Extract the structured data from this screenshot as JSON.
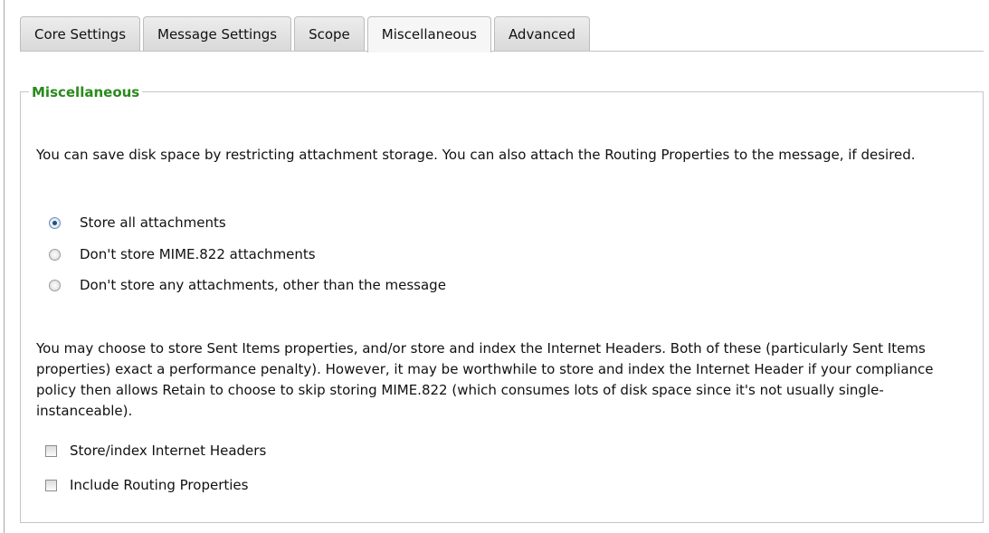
{
  "tabs": [
    {
      "label": "Core Settings",
      "active": false
    },
    {
      "label": "Message Settings",
      "active": false
    },
    {
      "label": "Scope",
      "active": false
    },
    {
      "label": "Miscellaneous",
      "active": true
    },
    {
      "label": "Advanced",
      "active": false
    }
  ],
  "section": {
    "legend": "Miscellaneous",
    "intro": "You can save disk space by restricting attachment storage. You can also attach the Routing Properties to the message, if desired.",
    "attachment_options": [
      {
        "label": "Store all attachments",
        "selected": true
      },
      {
        "label": "Don't store MIME.822 attachments",
        "selected": false
      },
      {
        "label": "Don't store any attachments, other than the message",
        "selected": false
      }
    ],
    "headers_text": "You may choose to store Sent Items properties, and/or store and index the Internet Headers. Both of these (particularly Sent Items properties) exact a performance penalty). However, it may be worthwhile to store and index the Internet Header if your compliance policy then allows Retain to choose to skip storing MIME.822 (which consumes lots of disk space since it's not usually single-instanceable).",
    "checkboxes": [
      {
        "label": "Store/index Internet Headers",
        "checked": false
      },
      {
        "label": "Include Routing Properties",
        "checked": false
      }
    ]
  },
  "colors": {
    "legend": "#2a8a1e",
    "radio_selected": "#1f4f88"
  }
}
